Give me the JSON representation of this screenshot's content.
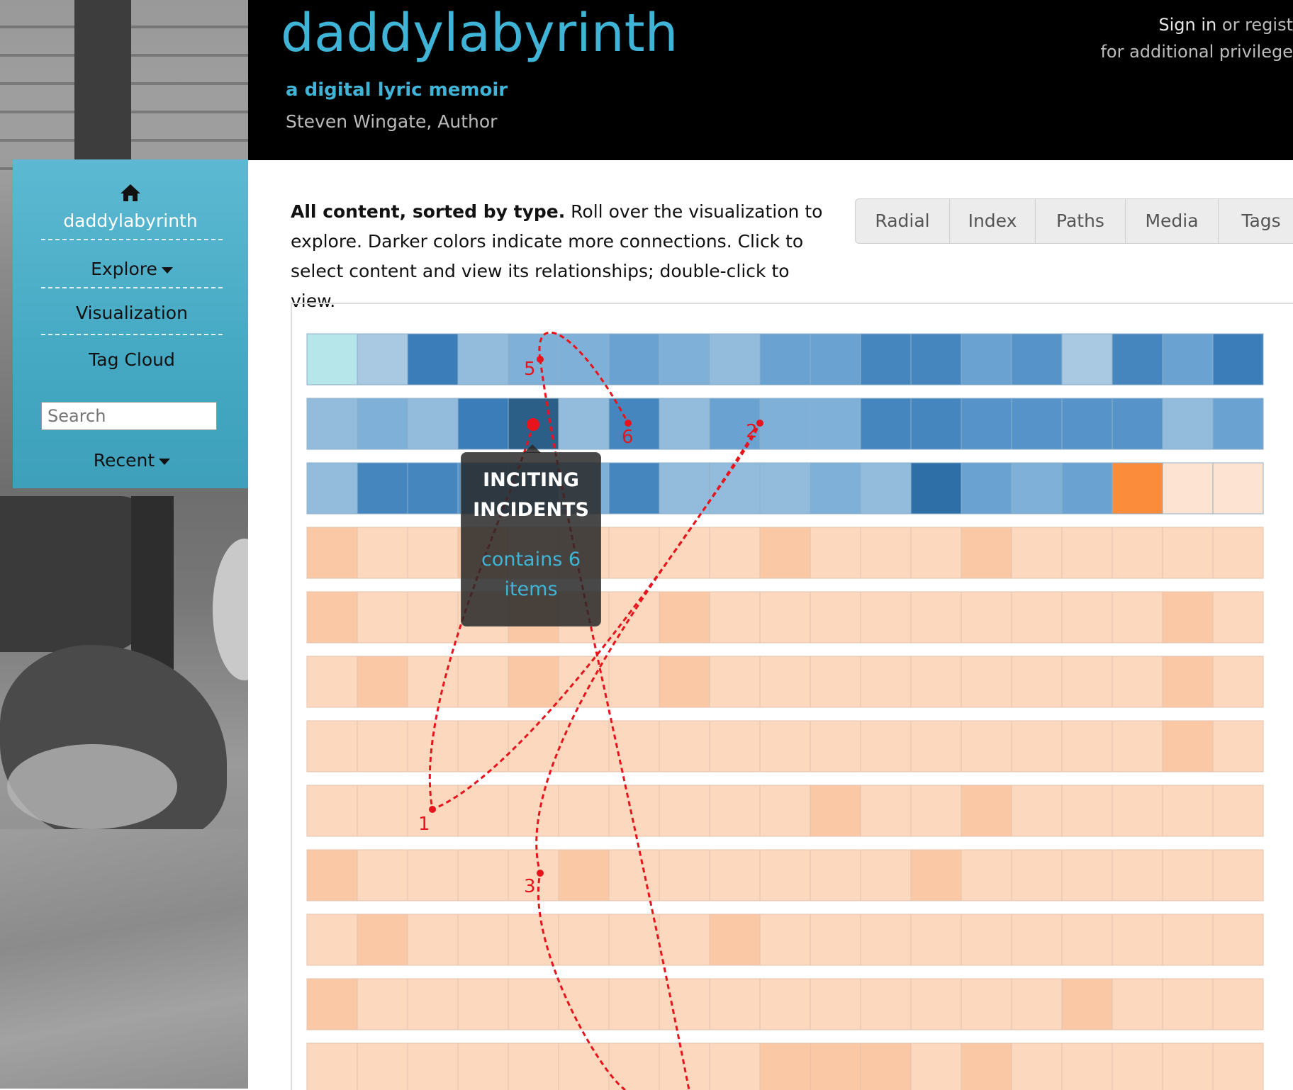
{
  "header": {
    "site_title": "daddylabyrinth",
    "subtitle": "a digital lyric memoir",
    "author": "Steven Wingate, Author",
    "signin_link": "Sign in",
    "signin_mid": " or regist",
    "signin_line2": "for additional privilege"
  },
  "sidebar": {
    "home_icon": "home-icon",
    "site_label": "daddylabyrinth",
    "explore_label": "Explore",
    "visualization_label": "Visualization",
    "tagcloud_label": "Tag Cloud",
    "search_placeholder": "Search",
    "recent_label": "Recent"
  },
  "intro": {
    "bold": "All content, sorted by type.",
    "rest": " Roll over the visualization to explore. Darker colors indicate more connections. Click to select content and view its relationships; double-click to view."
  },
  "tabs": [
    "Radial",
    "Index",
    "Paths",
    "Media",
    "Tags"
  ],
  "tooltip": {
    "title_line1": "INCITING",
    "title_line2": "INCIDENTS",
    "count_line1": "contains 6",
    "count_line2": "items"
  },
  "path_labels": [
    "1",
    "2",
    "3",
    "5",
    "6"
  ],
  "colors": {
    "brand": "#3fb4d6",
    "path": "#e8141c",
    "blue_scale": [
      "#b6e5ea",
      "#a9c9e2",
      "#93bcdc",
      "#7fb0d8",
      "#6aa2d1",
      "#5593c8",
      "#4586bf",
      "#3a7db8",
      "#2e6fa8",
      "#2c5f88"
    ],
    "orange_scale": [
      "#fde4d2",
      "#fcd8bf",
      "#fbc8a5",
      "#fb8c3c"
    ]
  },
  "grid": {
    "blue_rows": [
      [
        0,
        1,
        7,
        2,
        3,
        3,
        4,
        3,
        2,
        4,
        4,
        6,
        6,
        4,
        5,
        1,
        6,
        4,
        7
      ],
      [
        2,
        3,
        2,
        7,
        9,
        2,
        6,
        2,
        4,
        3,
        3,
        6,
        6,
        5,
        5,
        5,
        5,
        2,
        4
      ],
      [
        2,
        6,
        6,
        5,
        5,
        3,
        6,
        2,
        2,
        2,
        3,
        2,
        8,
        4,
        3,
        4,
        10,
        11,
        11
      ]
    ],
    "orange_rows": [
      [
        2,
        1,
        1,
        2,
        1,
        1,
        1,
        1,
        1,
        2,
        1,
        1,
        1,
        2,
        1,
        1,
        1,
        1,
        1
      ],
      [
        2,
        1,
        1,
        1,
        2,
        1,
        1,
        2,
        1,
        1,
        1,
        1,
        1,
        1,
        1,
        1,
        1,
        2,
        1
      ],
      [
        1,
        2,
        1,
        1,
        2,
        1,
        1,
        2,
        1,
        1,
        1,
        1,
        1,
        1,
        1,
        1,
        1,
        2,
        1
      ],
      [
        1,
        1,
        1,
        1,
        1,
        1,
        1,
        1,
        1,
        1,
        1,
        1,
        1,
        1,
        1,
        1,
        1,
        2,
        1
      ],
      [
        1,
        1,
        1,
        1,
        1,
        1,
        1,
        1,
        1,
        1,
        2,
        1,
        1,
        2,
        1,
        1,
        1,
        1,
        1
      ],
      [
        2,
        1,
        1,
        1,
        1,
        2,
        1,
        1,
        1,
        1,
        1,
        1,
        2,
        1,
        1,
        1,
        1,
        1,
        1
      ],
      [
        1,
        2,
        1,
        1,
        1,
        1,
        1,
        1,
        2,
        1,
        1,
        1,
        1,
        1,
        1,
        1,
        1,
        1,
        1
      ],
      [
        2,
        1,
        1,
        1,
        1,
        1,
        1,
        1,
        1,
        1,
        1,
        1,
        1,
        1,
        1,
        2,
        1,
        1,
        1
      ],
      [
        1,
        1,
        1,
        1,
        1,
        1,
        1,
        1,
        1,
        2,
        2,
        2,
        1,
        2,
        1,
        1,
        1,
        1,
        1
      ]
    ]
  }
}
